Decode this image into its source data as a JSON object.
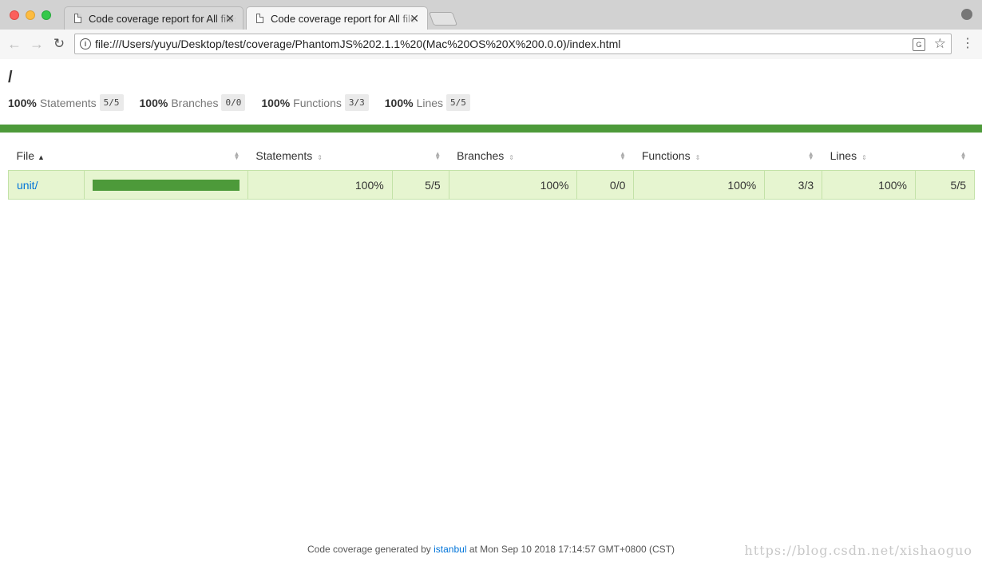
{
  "browser": {
    "tabs": [
      {
        "title": "Code coverage report for All files"
      },
      {
        "title": "Code coverage report for All files"
      }
    ],
    "close_glyph": "✕",
    "url": "file:///Users/yuyu/Desktop/test/coverage/PhantomJS%202.1.1%20(Mac%20OS%20X%200.0.0)/index.html",
    "icons": [
      "back-icon",
      "forward-icon",
      "reload-icon",
      "info-icon",
      "translate-icon",
      "star-icon",
      "menu-icon",
      "profile-icon"
    ]
  },
  "report": {
    "path": "/",
    "summary": [
      {
        "pct": "100%",
        "label": "Statements",
        "frac": "5/5"
      },
      {
        "pct": "100%",
        "label": "Branches",
        "frac": "0/0"
      },
      {
        "pct": "100%",
        "label": "Functions",
        "frac": "3/3"
      },
      {
        "pct": "100%",
        "label": "Lines",
        "frac": "5/5"
      }
    ],
    "headers": {
      "file": "File",
      "statements": "Statements",
      "branches": "Branches",
      "functions": "Functions",
      "lines": "Lines"
    },
    "rows": [
      {
        "file": "unit/",
        "coverage": 1.0,
        "statements_pct": "100%",
        "statements_frac": "5/5",
        "branches_pct": "100%",
        "branches_frac": "0/0",
        "functions_pct": "100%",
        "functions_frac": "3/3",
        "lines_pct": "100%",
        "lines_frac": "5/5"
      }
    ],
    "status_color": "#4d9a3a"
  },
  "footer": {
    "prefix": "Code coverage generated by",
    "link": "istanbul",
    "suffix": "at Mon Sep 10 2018 17:14:57 GMT+0800 (CST)"
  },
  "watermark": "https://blog.csdn.net/xishaoguo"
}
